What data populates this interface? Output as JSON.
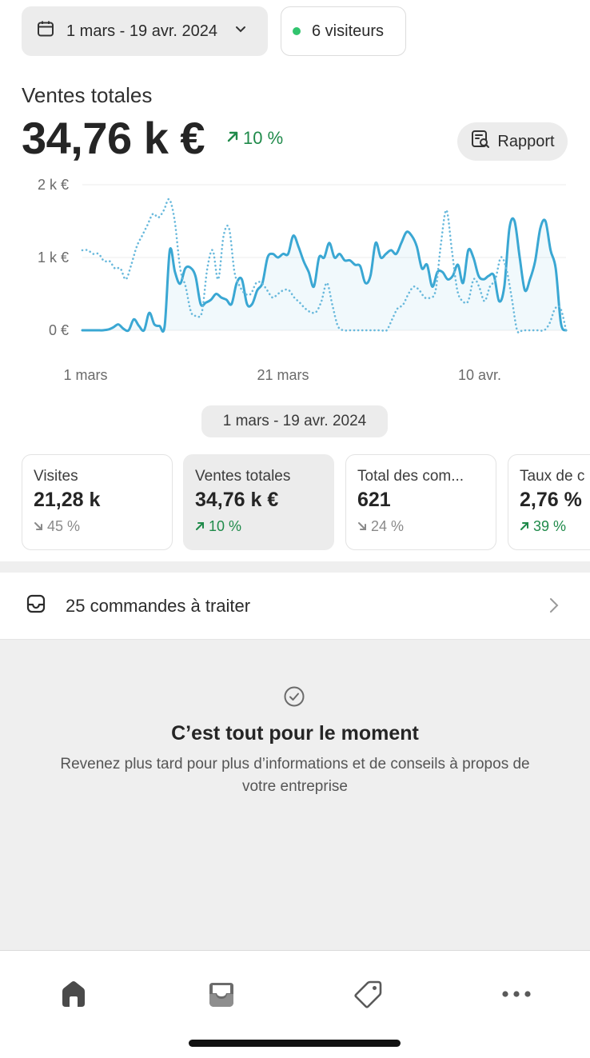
{
  "header": {
    "date_range": "1 mars - 19 avr. 2024",
    "visitors": "6 visiteurs"
  },
  "sales": {
    "label": "Ventes totales",
    "value": "34,76 k €",
    "trend": "10 %",
    "report_label": "Rapport"
  },
  "chart_data": {
    "type": "line",
    "y_ticks": [
      "2 k €",
      "1 k €",
      "0 €"
    ],
    "x_ticks": [
      "1 mars",
      "21 mars",
      "10 avr."
    ],
    "ylim": [
      0,
      2000
    ],
    "grid": true,
    "series": [
      {
        "style": "solid",
        "color": "#3aa7d3",
        "values": [
          0,
          0,
          0,
          0,
          0,
          10,
          40,
          80,
          20,
          0,
          150,
          60,
          0,
          240,
          80,
          60,
          60,
          1100,
          800,
          640,
          850,
          860,
          740,
          360,
          380,
          420,
          500,
          450,
          420,
          360,
          650,
          700,
          360,
          360,
          550,
          650,
          1000,
          1050,
          1000,
          1050,
          1050,
          1300,
          1150,
          950,
          800,
          600,
          1000,
          1000,
          1200,
          1000,
          1050,
          960,
          960,
          900,
          880,
          650,
          750,
          1200,
          1000,
          1050,
          1100,
          1050,
          1200,
          1350,
          1300,
          1150,
          850,
          900,
          600,
          800,
          800,
          700,
          750,
          900,
          650,
          1100,
          1000,
          750,
          700,
          750,
          750,
          400,
          600,
          1400,
          1500,
          1000,
          550,
          700,
          950,
          1400,
          1500,
          1100,
          850,
          100,
          0
        ],
        "note_x_range": [
          "1 mars",
          "19 avr."
        ]
      },
      {
        "style": "dotted",
        "color": "#69b9dc",
        "values": [
          1100,
          1100,
          1050,
          1050,
          950,
          950,
          850,
          850,
          700,
          900,
          1150,
          1300,
          1450,
          1600,
          1550,
          1650,
          1800,
          1500,
          850,
          600,
          250,
          200,
          250,
          850,
          1100,
          700,
          1300,
          1400,
          800,
          600,
          500,
          500,
          650,
          650,
          550,
          450,
          500,
          550,
          550,
          450,
          380,
          300,
          250,
          250,
          400,
          650,
          350,
          60,
          0,
          0,
          0,
          0,
          0,
          0,
          0,
          0,
          0,
          150,
          300,
          350,
          500,
          600,
          550,
          450,
          450,
          550,
          1200,
          1650,
          1100,
          550,
          400,
          400,
          700,
          600,
          400,
          600,
          700,
          1000,
          850,
          450,
          0,
          0,
          0,
          0,
          0,
          0,
          100,
          300,
          300,
          0
        ]
      }
    ]
  },
  "range_badge": "1 mars - 19 avr. 2024",
  "metrics": [
    {
      "title": "Visites",
      "value": "21,28 k",
      "trend": "45 %",
      "direction": "down"
    },
    {
      "title": "Ventes totales",
      "value": "34,76 k €",
      "trend": "10 %",
      "direction": "up"
    },
    {
      "title": "Total des com...",
      "value": "621",
      "trend": "24 %",
      "direction": "down"
    },
    {
      "title": "Taux de c",
      "value": "2,76 %",
      "trend": "39 %",
      "direction": "up"
    }
  ],
  "orders": {
    "label": "25 commandes à traiter"
  },
  "empty_state": {
    "title": "C’est tout pour le moment",
    "subtitle": "Revenez plus tard pour plus d’informations et de conseils à propos de votre entreprise"
  },
  "nav": {
    "items": [
      "home-icon",
      "inbox-icon",
      "tag-icon",
      "more-icon"
    ]
  }
}
